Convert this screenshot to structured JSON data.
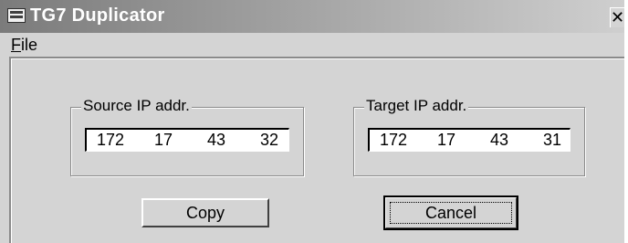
{
  "window": {
    "title": "TG7 Duplicator",
    "close_glyph": "✕",
    "icon": "app-icon"
  },
  "menu": {
    "file_mnemonic": "F",
    "file_rest": "ile"
  },
  "source": {
    "label": "Source IP addr.",
    "octets": [
      "172",
      "17",
      "43",
      "32"
    ]
  },
  "target": {
    "label": "Target IP addr.",
    "octets": [
      "172",
      "17",
      "43",
      "31"
    ]
  },
  "buttons": {
    "copy": "Copy",
    "cancel": "Cancel"
  }
}
